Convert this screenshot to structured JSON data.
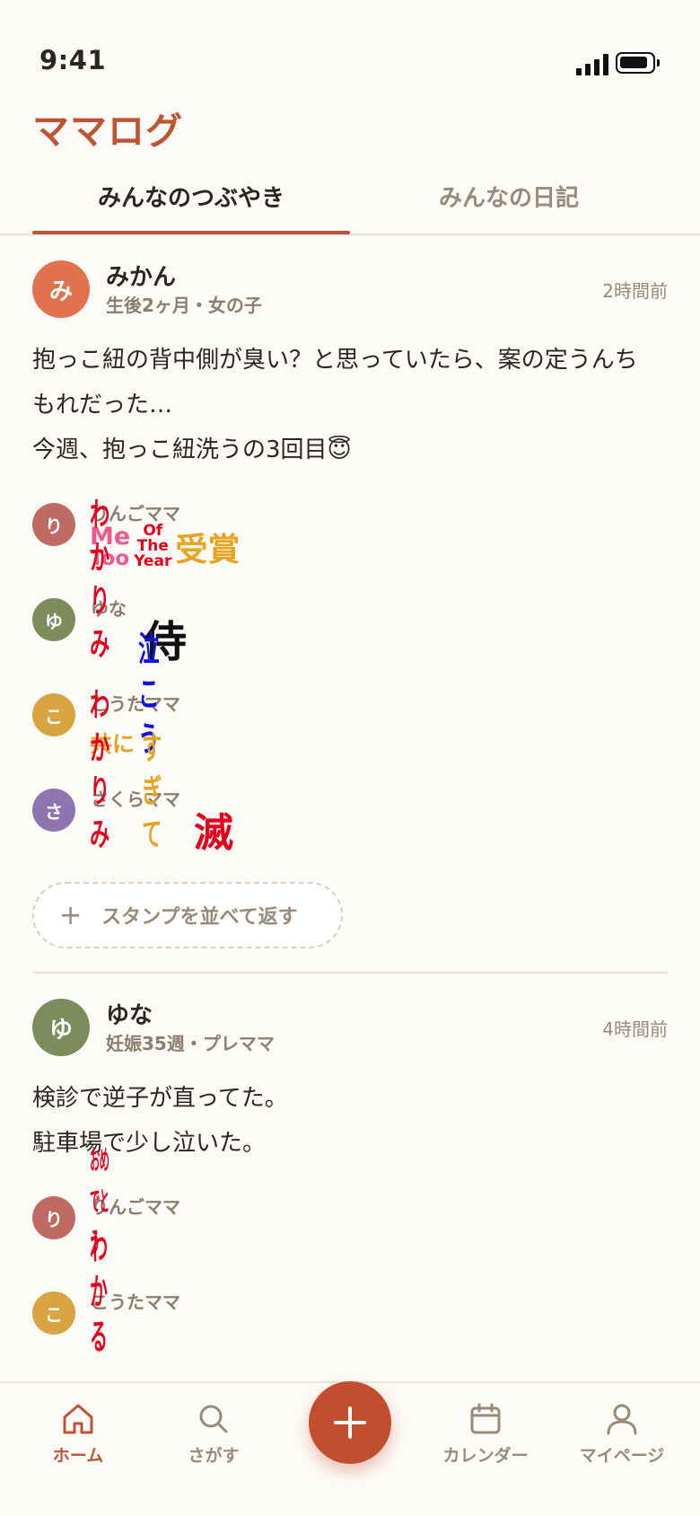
{
  "status": {
    "time": "9:41"
  },
  "app": {
    "title": "ママログ"
  },
  "tabs": [
    {
      "label": "みんなのつぶやき",
      "active": true
    },
    {
      "label": "みんなの日記",
      "active": false
    }
  ],
  "posts": [
    {
      "avatar": "み",
      "author": "みかん",
      "meta": "生後2ヶ月・女の子",
      "ago": "2時間前",
      "lines": [
        "抱っこ紐の背中側が臭い？と思っていたら、案の定うんち",
        "もれだった…",
        "今週、抱っこ紐洗うの3回目😇"
      ],
      "reactions": [
        {
          "avatar": "り",
          "name": "りんごママ",
          "stamp": [
            "Me",
            "Too",
            "Of",
            "The",
            "Year",
            "受賞"
          ]
        },
        {
          "avatar": "ゆ",
          "name": "ゆな",
          "stamp": [
            "わかりみ",
            "侍"
          ]
        },
        {
          "avatar": "こ",
          "name": "こうたママ",
          "stamp": [
            "共に",
            "泣こう"
          ]
        },
        {
          "avatar": "さ",
          "name": "さくらママ",
          "stamp": [
            "わかりみ",
            "すぎて",
            "滅"
          ]
        }
      ],
      "reply_label": "スタンプを並べて返す"
    },
    {
      "avatar": "ゆ",
      "author": "ゆな",
      "meta": "妊娠35週・プレママ",
      "ago": "4時間前",
      "lines": [
        "検診で逆子が直ってた。",
        "駐車場で少し泣いた。"
      ],
      "reactions": [
        {
          "avatar": "り",
          "name": "りんごママ",
          "stamp": [
            "おめでとう"
          ]
        },
        {
          "avatar": "こ",
          "name": "こうたママ",
          "stamp": [
            "わかる"
          ]
        }
      ]
    }
  ],
  "nav": {
    "home": "ホーム",
    "search": "さがす",
    "calendar": "カレンダー",
    "mypage": "マイページ"
  },
  "colors": {
    "accent": "#bf5434",
    "avatar_mikan": "#e07250",
    "avatar_ringo": "#c06a64",
    "avatar_yuna": "#7e8c5d",
    "avatar_kouta": "#d9a441",
    "avatar_sakura": "#8f75b0"
  }
}
